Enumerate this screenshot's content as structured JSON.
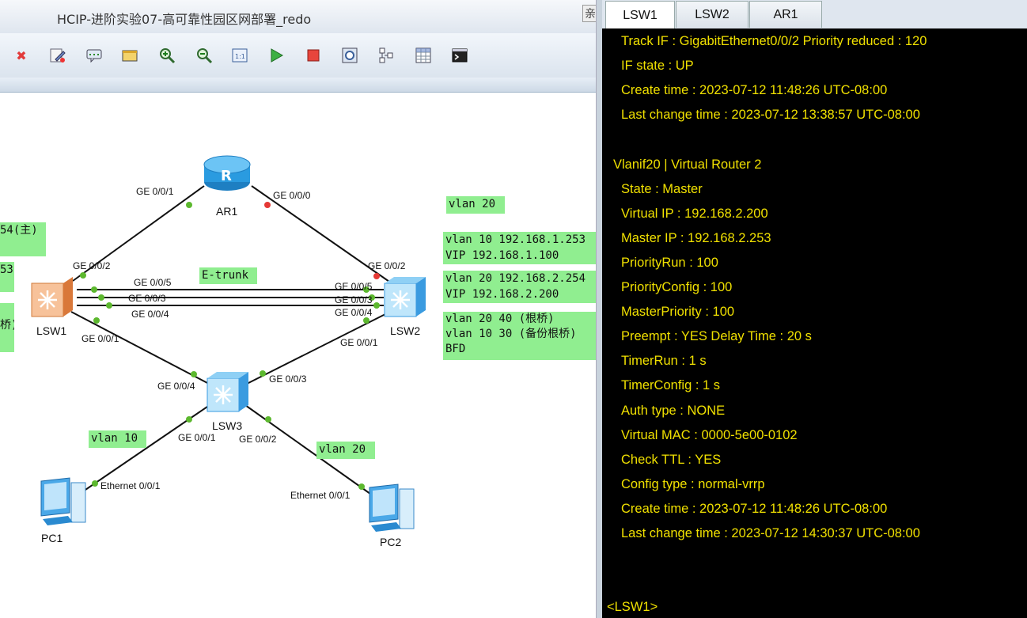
{
  "window": {
    "title": "HCIP-进阶实验07-高可靠性园区网部署_redo",
    "edge_char": "亲"
  },
  "toolbar": {
    "icons": [
      "close-icon",
      "edit-icon",
      "comment-icon",
      "rectangle-icon",
      "zoom-in-icon",
      "zoom-out-icon",
      "fit-icon",
      "play-icon",
      "stop-icon",
      "capture-icon",
      "topology-icon",
      "grid-icon",
      "terminal-icon"
    ]
  },
  "topology": {
    "devices": {
      "ar1": "AR1",
      "lsw1": "LSW1",
      "lsw2": "LSW2",
      "lsw3": "LSW3",
      "pc1": "PC1",
      "pc2": "PC2"
    },
    "ports": {
      "ar1_g001": "GE 0/0/1",
      "ar1_g000": "GE 0/0/0",
      "lsw1_g002": "GE 0/0/2",
      "lsw1_g005": "GE 0/0/5",
      "lsw1_g003": "GE 0/0/3",
      "lsw1_g004": "GE 0/0/4",
      "lsw1_g001": "GE 0/0/1",
      "lsw2_g002": "GE 0/0/2",
      "lsw2_g005": "GE 0/0/5",
      "lsw2_g003": "GE 0/0/3",
      "lsw2_g004": "GE 0/0/4",
      "lsw2_g001": "GE 0/0/1",
      "lsw3_g004": "GE 0/0/4",
      "lsw3_g003": "GE 0/0/3",
      "lsw3_g001": "GE 0/0/1",
      "lsw3_g002": "GE 0/0/2",
      "pc1_eth": "Ethernet 0/0/1",
      "pc2_eth": "Ethernet 0/0/1"
    },
    "notes": {
      "vlan20_top": "vlan 20",
      "lsw2_vlan10": "vlan 10 192.168.1.253\nVIP 192.168.1.100",
      "lsw2_vlan20": "vlan 20 192.168.2.254\nVIP 192.168.2.200",
      "lsw2_root": "vlan 20 40 (根桥)\nvlan 10 30 (备份根桥)\nBFD",
      "etrunk": "E-trunk",
      "vlan10_pc": "vlan 10",
      "vlan20_pc": "vlan 20",
      "left_a": "54(主)",
      "left_b": "53",
      "left_c": "桥)"
    }
  },
  "terminal": {
    "tabs": [
      "LSW1",
      "LSW2",
      "AR1"
    ],
    "active_tab": "LSW1",
    "lines": [
      "Track IF : GigabitEthernet0/0/2   Priority reduced : 120",
      "IF state : UP",
      "Create time : 2023-07-12 11:48:26 UTC-08:00",
      "Last change time : 2023-07-12 13:38:57 UTC-08:00",
      "",
      "Vlanif20 | Virtual Router 2",
      "State : Master",
      "Virtual IP : 192.168.2.200",
      "Master IP : 192.168.2.253",
      "PriorityRun : 100",
      "PriorityConfig : 100",
      "MasterPriority : 100",
      "Preempt : YES   Delay Time : 20 s",
      "TimerRun : 1 s",
      "TimerConfig : 1 s",
      "Auth type : NONE",
      "Virtual MAC : 0000-5e00-0102",
      "Check TTL : YES",
      "Config type : normal-vrrp",
      "Create time : 2023-07-12 11:48:26 UTC-08:00",
      "Last change time : 2023-07-12 14:30:37 UTC-08:00",
      "",
      "",
      "<LSW1>"
    ]
  },
  "colors": {
    "note_bg": "#90ee90",
    "term_text": "#f0e000",
    "port_up": "#5cb82e",
    "port_down": "#e53935"
  }
}
